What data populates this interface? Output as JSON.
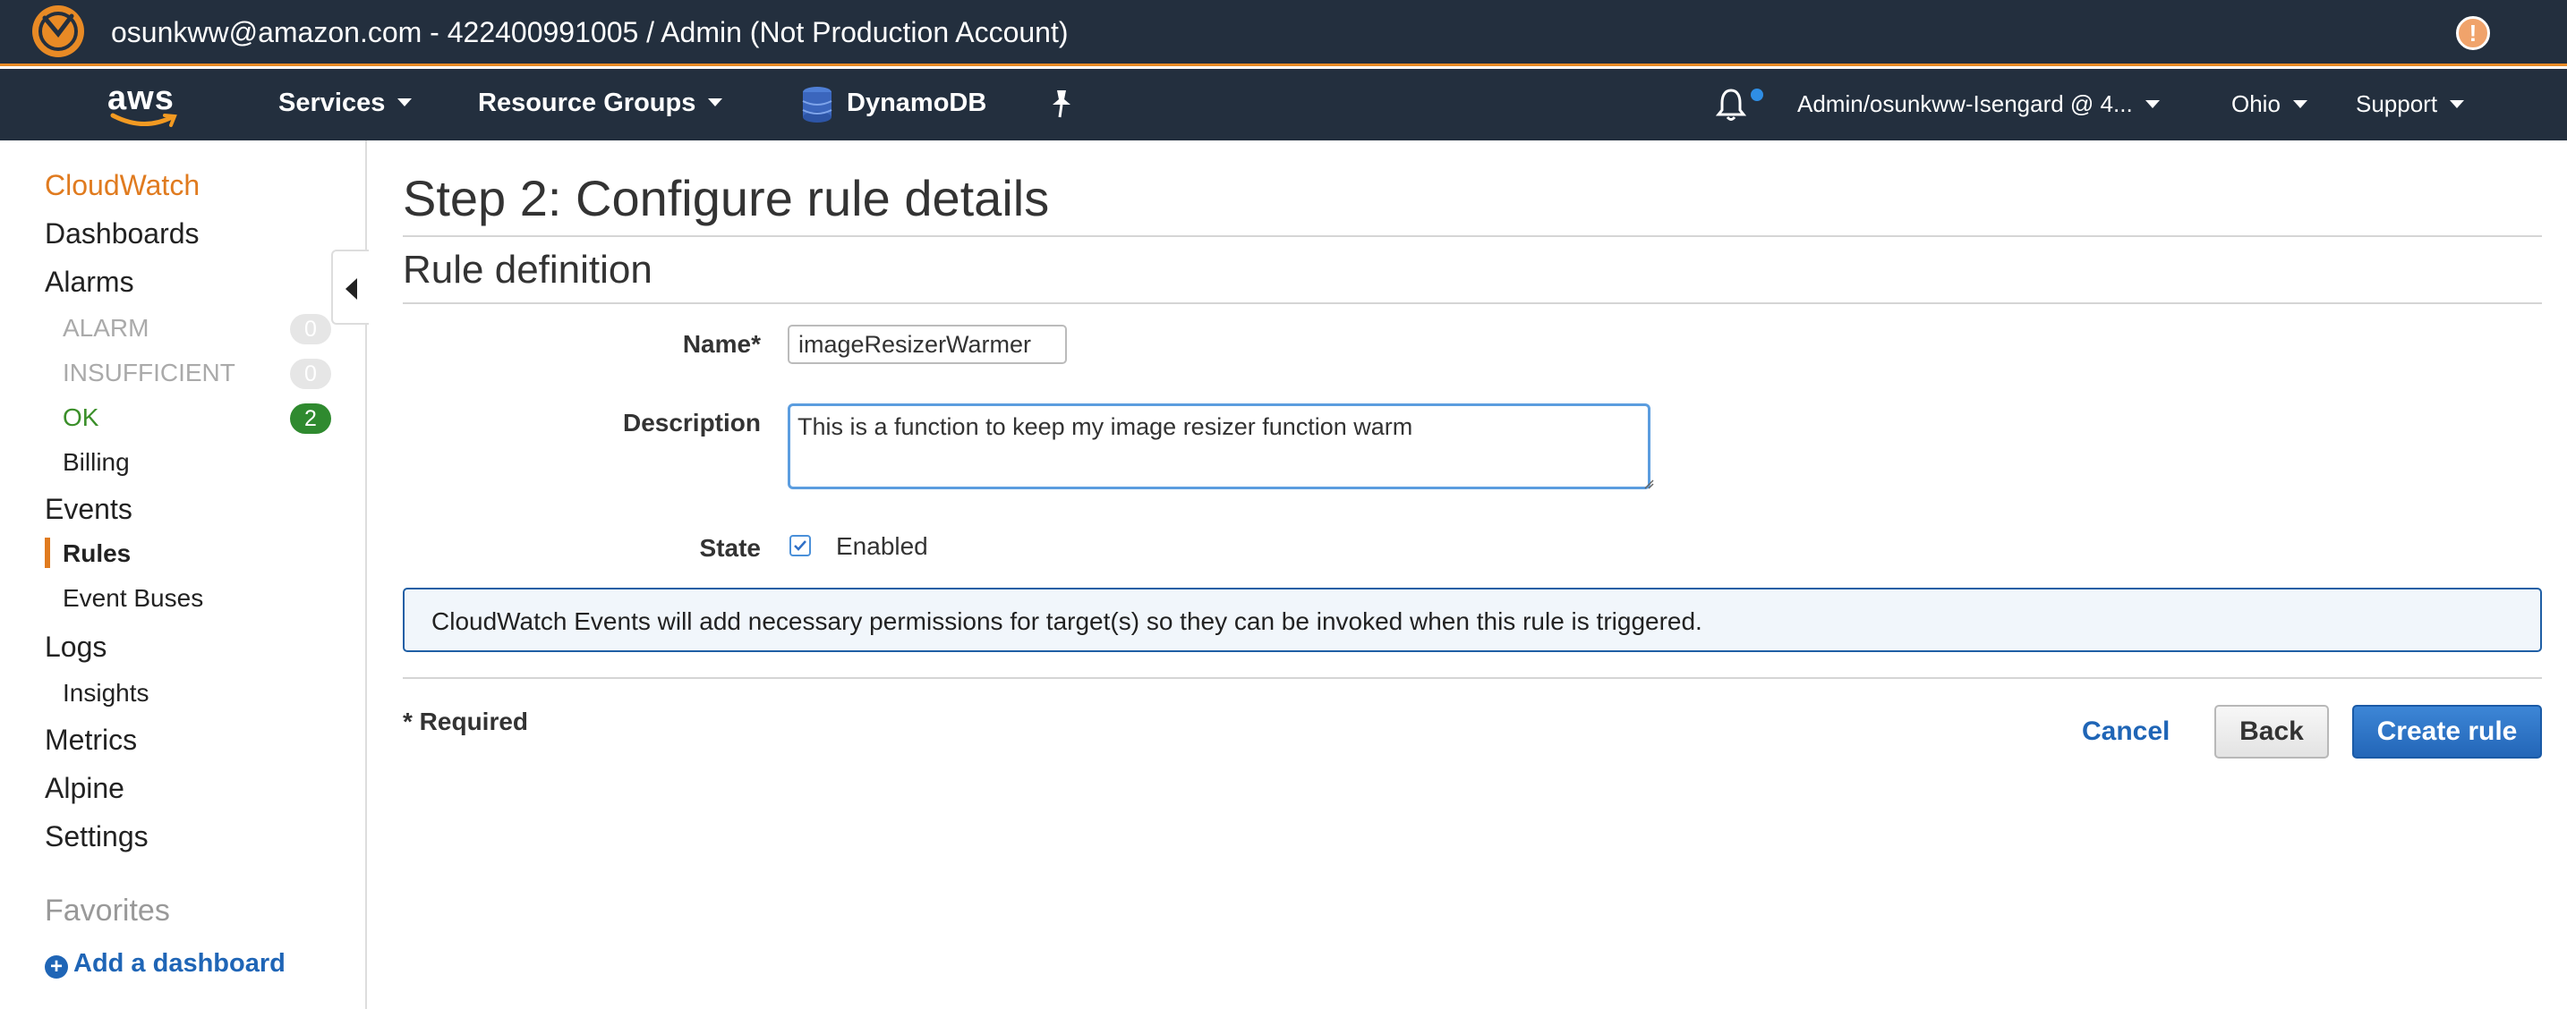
{
  "account_bar": {
    "title": "osunkww@amazon.com - 422400991005 / Admin (Not Production Account)",
    "alert_icon": "alert-icon"
  },
  "nav": {
    "logo_text": "aws",
    "services": "Services",
    "resource_groups": "Resource Groups",
    "dynamodb": "DynamoDB",
    "account": "Admin/osunkww-Isengard @ 4...",
    "region": "Ohio",
    "support": "Support",
    "colors": {
      "bar": "#232f3e",
      "accent": "#e88a25"
    }
  },
  "sidebar": {
    "cloudwatch": "CloudWatch",
    "dashboards": "Dashboards",
    "alarms": "Alarms",
    "alarm_states": [
      {
        "label": "ALARM",
        "count": "0"
      },
      {
        "label": "INSUFFICIENT",
        "count": "0"
      },
      {
        "label": "OK",
        "count": "2"
      }
    ],
    "billing": "Billing",
    "events": "Events",
    "rules": "Rules",
    "event_buses": "Event Buses",
    "logs": "Logs",
    "insights": "Insights",
    "metrics": "Metrics",
    "alpine": "Alpine",
    "settings": "Settings",
    "favorites": "Favorites",
    "add_dashboard": "Add a dashboard"
  },
  "main": {
    "page_title": "Step 2: Configure rule details",
    "section_title": "Rule definition",
    "name_label": "Name*",
    "name_value": "imageResizerWarmer",
    "description_label": "Description",
    "description_value": "This is a function to keep my image resizer function warm",
    "state_label": "State",
    "state_option": "Enabled",
    "state_checked": true,
    "info_text": "CloudWatch Events will add necessary permissions for target(s) so they can be invoked when this rule is triggered.",
    "required_note": "* Required",
    "cancel": "Cancel",
    "back": "Back",
    "create_rule": "Create rule"
  }
}
